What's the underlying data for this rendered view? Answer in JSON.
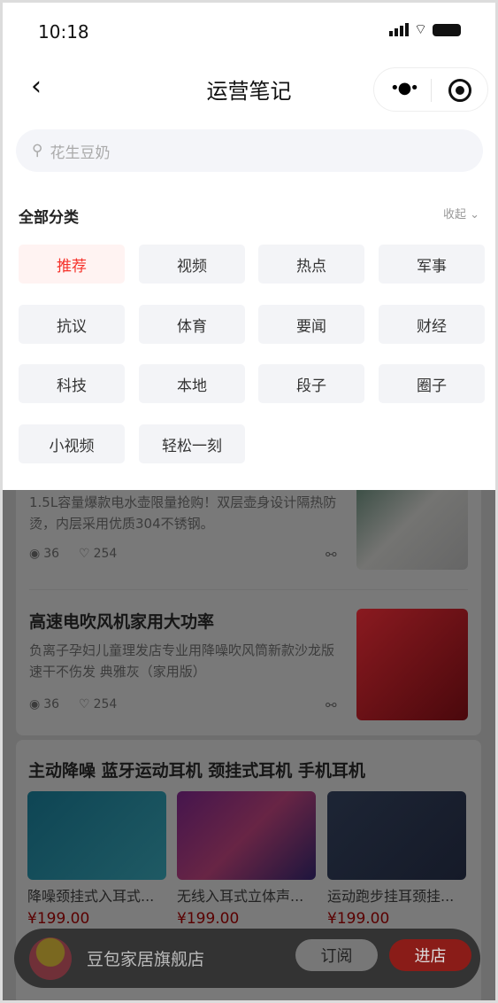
{
  "status_bar": {
    "time": "10:18"
  },
  "nav": {
    "title": "运营笔记"
  },
  "search": {
    "placeholder": "花生豆奶"
  },
  "categories": {
    "heading": "全部分类",
    "collapse_label": "收起",
    "items": [
      "推荐",
      "视频",
      "热点",
      "军事",
      "抗议",
      "体育",
      "要闻",
      "财经",
      "科技",
      "本地",
      "段子",
      "圈子",
      "小视频",
      "轻松一刻"
    ],
    "active_index": 0
  },
  "articles": [
    {
      "title": "",
      "desc": "1.5L容量爆款电水壶限量抢购！双层壶身设计隔热防烫，内层采用优质304不锈钢。",
      "views": "36",
      "likes": "254"
    },
    {
      "title": "高速电吹风机家用大功率",
      "desc": "负离子孕妇儿童理发店专业用降噪吹风筒新款沙龙版速干不伤发 典雅灰（家用版）",
      "views": "36",
      "likes": "254"
    }
  ],
  "product_card": {
    "title": "主动降噪 蓝牙运动耳机 颈挂式耳机 手机耳机",
    "products": [
      {
        "name": "降噪颈挂式入耳式...",
        "price": "¥199.00"
      },
      {
        "name": "无线入耳式立体声...",
        "price": "¥199.00"
      },
      {
        "name": "运动跑步挂耳颈挂...",
        "price": "¥199.00"
      }
    ]
  },
  "shop": {
    "name": "豆包家居旗舰店",
    "subscribe_label": "订阅",
    "enter_label": "进店"
  },
  "colors": {
    "accent": "#f5322a",
    "tag_bg": "#f3f4f7",
    "active_tag_bg": "#fff3f2"
  }
}
